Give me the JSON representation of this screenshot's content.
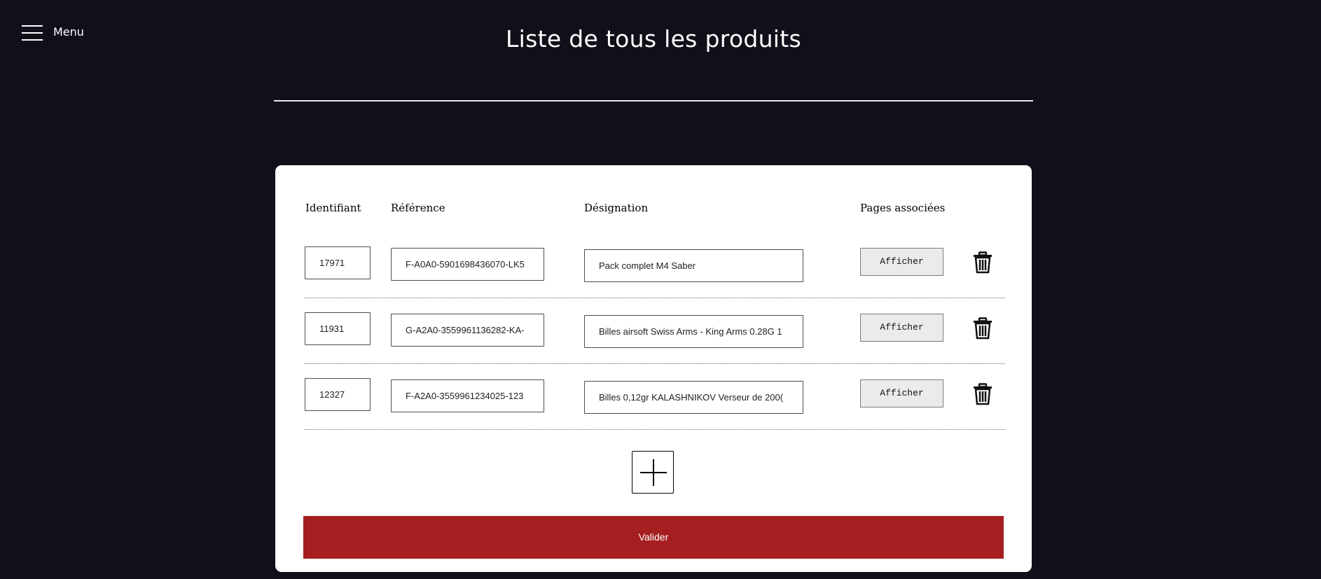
{
  "nav": {
    "menu_label": "Menu"
  },
  "page": {
    "title": "Liste de tous les produits"
  },
  "table": {
    "headers": {
      "id": "Identifiant",
      "reference": "Référence",
      "designation": "Désignation",
      "pages": "Pages associées"
    },
    "rows": [
      {
        "id": "17971",
        "reference": "F-A0A0-5901698436070-LK5",
        "designation": "Pack complet M4 Saber",
        "pages_button": "Afficher"
      },
      {
        "id": "11931",
        "reference": "G-A2A0-3559961136282-KA-",
        "designation": "Billes airsoft Swiss Arms - King Arms 0.28G 1",
        "pages_button": "Afficher"
      },
      {
        "id": "12327",
        "reference": "F-A2A0-3559961234025-123",
        "designation": "Billes 0,12gr KALASHNIKOV Verseur de 200(",
        "pages_button": "Afficher"
      }
    ]
  },
  "actions": {
    "submit_label": "Valider",
    "add_icon": "plus-icon",
    "delete_icon": "trash-icon"
  },
  "colors": {
    "background": "#11101a",
    "card": "#ffffff",
    "submit": "#a51f20"
  }
}
